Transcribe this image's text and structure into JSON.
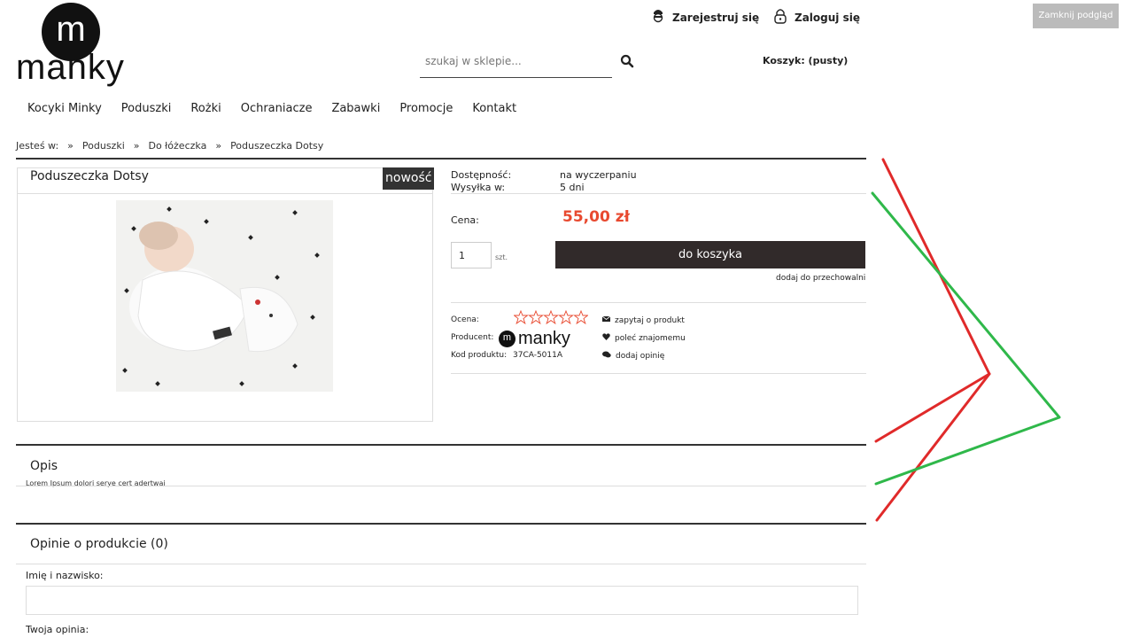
{
  "header": {
    "logo_letter": "m",
    "logo_text": "manky",
    "register_label": "Zarejestruj się",
    "login_label": "Zaloguj się",
    "close_preview_label": "Zamknij podgląd",
    "search_placeholder": "szukaj w sklepie...",
    "cart_label": "Koszyk: (pusty)"
  },
  "nav": [
    "Kocyki Minky",
    "Poduszki",
    "Rożki",
    "Ochraniacze",
    "Zabawki",
    "Promocje",
    "Kontakt"
  ],
  "breadcrumb": {
    "prefix": "Jesteś w:",
    "sep": "»",
    "items": [
      "Poduszki",
      "Do łóżeczka",
      "Poduszeczka Dotsy"
    ]
  },
  "product": {
    "title": "Poduszeczka Dotsy",
    "badge": "nowość",
    "availability_label": "Dostępność:",
    "availability_value": "na wyczerpaniu",
    "shipping_label": "Wysyłka w:",
    "shipping_value": "5 dni",
    "price_label": "Cena:",
    "price": "55,00 zł",
    "qty_value": "1",
    "qty_unit": "szt.",
    "add_to_cart": "do koszyka",
    "wishlist": "dodaj do przechowalni",
    "rating_label": "Ocena:",
    "rating_value": 0,
    "rating_max": 5,
    "producer_label": "Producent:",
    "producer_letter": "m",
    "producer_name": "manky",
    "code_label": "Kod produktu:",
    "code_value": "37CA-5011A",
    "ask_label": "zapytaj o produkt",
    "recommend_label": "poleć znajomemu",
    "review_label": "dodaj opinię"
  },
  "description": {
    "title": "Opis",
    "text": "Lorem Ipsum dolori serye cert adertwai"
  },
  "reviews": {
    "title": "Opinie o produkcie (0)",
    "name_label": "Imię i nazwisko:",
    "opinion_label": "Twoja opinia:"
  },
  "colors": {
    "price": "#e8492f",
    "button": "#312a2a",
    "annotation_red": "#e02a2a",
    "annotation_green": "#2fb84a"
  }
}
